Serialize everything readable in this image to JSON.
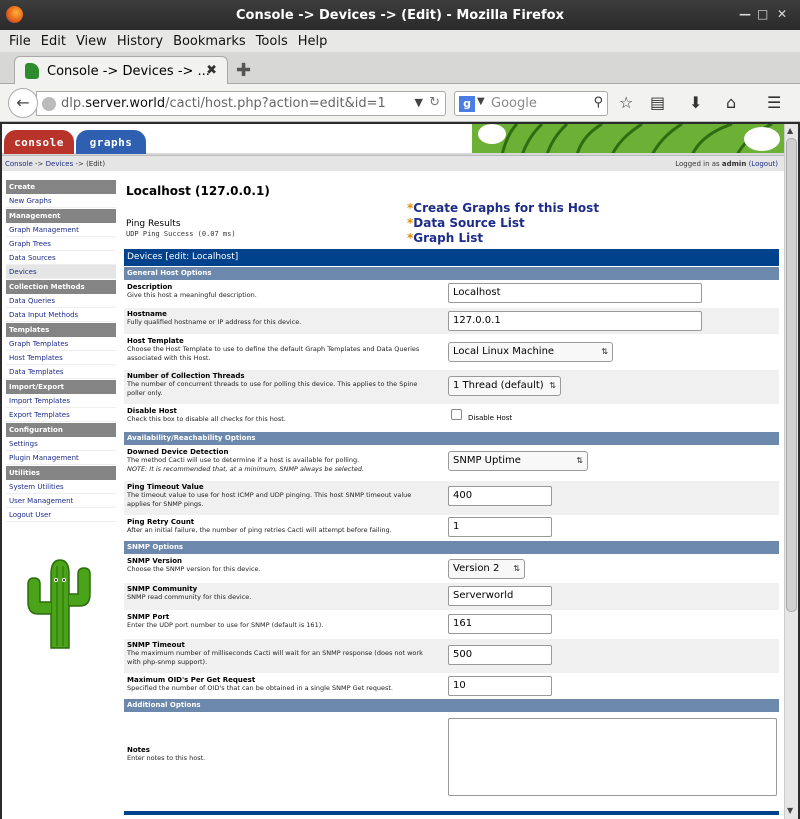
{
  "window": {
    "title": "Console -> Devices -> (Edit) - Mozilla Firefox"
  },
  "menu": [
    "File",
    "Edit",
    "View",
    "History",
    "Bookmarks",
    "Tools",
    "Help"
  ],
  "tab": {
    "label": "Console -> Devices -> ..."
  },
  "url": {
    "prefix": "dlp.",
    "domain": "server.world",
    "path": "/cacti/host.php?action=edit&id=1"
  },
  "search": {
    "placeholder": "Google"
  },
  "cacti": {
    "tabs": {
      "console": "console",
      "graphs": "graphs"
    },
    "breadcrumb": {
      "console": "Console",
      "sep1": " -> ",
      "devices": "Devices",
      "sep2": " -> ",
      "edit": "(Edit)"
    },
    "login": {
      "prefix": "Logged in as ",
      "user": "admin",
      "logout": "(Logout)"
    }
  },
  "sidebar": [
    {
      "type": "hd",
      "label": "Create"
    },
    {
      "type": "it",
      "label": "New Graphs"
    },
    {
      "type": "hd",
      "label": "Management"
    },
    {
      "type": "it",
      "label": "Graph Management"
    },
    {
      "type": "it",
      "label": "Graph Trees"
    },
    {
      "type": "it",
      "label": "Data Sources"
    },
    {
      "type": "it",
      "label": "Devices",
      "active": true
    },
    {
      "type": "hd",
      "label": "Collection Methods"
    },
    {
      "type": "it",
      "label": "Data Queries"
    },
    {
      "type": "it",
      "label": "Data Input Methods"
    },
    {
      "type": "hd",
      "label": "Templates"
    },
    {
      "type": "it",
      "label": "Graph Templates"
    },
    {
      "type": "it",
      "label": "Host Templates"
    },
    {
      "type": "it",
      "label": "Data Templates"
    },
    {
      "type": "hd",
      "label": "Import/Export"
    },
    {
      "type": "it",
      "label": "Import Templates"
    },
    {
      "type": "it",
      "label": "Export Templates"
    },
    {
      "type": "hd",
      "label": "Configuration"
    },
    {
      "type": "it",
      "label": "Settings"
    },
    {
      "type": "it",
      "label": "Plugin Management"
    },
    {
      "type": "hd",
      "label": "Utilities"
    },
    {
      "type": "it",
      "label": "System Utilities"
    },
    {
      "type": "it",
      "label": "User Management"
    },
    {
      "type": "it",
      "label": "Logout User"
    }
  ],
  "host": {
    "title": "Localhost (127.0.0.1)",
    "ping_label": "Ping Results",
    "ping_value": "UDP Ping Success (0.07 ms)",
    "links": [
      "Create Graphs for this Host",
      "Data Source List",
      "Graph List"
    ]
  },
  "devbar": {
    "title": "Devices",
    "sub": " [edit: Localhost]"
  },
  "sections": {
    "general": "General Host Options",
    "avail": "Availability/Reachability Options",
    "snmp": "SNMP Options",
    "additional": "Additional Options"
  },
  "fields": {
    "description": {
      "label": "Description",
      "desc": "Give this host a meaningful description.",
      "value": "Localhost"
    },
    "hostname": {
      "label": "Hostname",
      "desc": "Fully qualified hostname or IP address for this device.",
      "value": "127.0.0.1"
    },
    "host_template": {
      "label": "Host Template",
      "desc": "Choose the Host Template to use to define the default Graph Templates and Data Queries associated with this Host.",
      "value": "Local Linux Machine"
    },
    "threads": {
      "label": "Number of Collection Threads",
      "desc": "The number of concurrent threads to use for polling this device. This applies to the Spine poller only.",
      "value": "1 Thread (default)"
    },
    "disable": {
      "label": "Disable Host",
      "desc": "Check this box to disable all checks for this host.",
      "checkbox_label": "Disable Host"
    },
    "downed": {
      "label": "Downed Device Detection",
      "desc": "The method Cacti will use to determine if a host is available for polling.",
      "note": "NOTE: It is recommended that, at a minimum, SNMP always be selected.",
      "value": "SNMP Uptime"
    },
    "ping_timeout": {
      "label": "Ping Timeout Value",
      "desc": "The timeout value to use for host ICMP and UDP pinging. This host SNMP timeout value applies for SNMP pings.",
      "value": "400"
    },
    "ping_retry": {
      "label": "Ping Retry Count",
      "desc": "After an initial failure, the number of ping retries Cacti will attempt before failing.",
      "value": "1"
    },
    "snmp_version": {
      "label": "SNMP Version",
      "desc": "Choose the SNMP version for this device.",
      "value": "Version 2"
    },
    "snmp_community": {
      "label": "SNMP Community",
      "desc": "SNMP read community for this device.",
      "value": "Serverworld"
    },
    "snmp_port": {
      "label": "SNMP Port",
      "desc": "Enter the UDP port number to use for SNMP (default is 161).",
      "value": "161"
    },
    "snmp_timeout": {
      "label": "SNMP Timeout",
      "desc": "The maximum number of milliseconds Cacti will wait for an SNMP response (does not work with php-snmp support).",
      "value": "500"
    },
    "max_oids": {
      "label": "Maximum OID's Per Get Request",
      "desc": "Specified the number of OID's that can be obtained in a single SNMP Get request.",
      "value": "10"
    },
    "notes": {
      "label": "Notes",
      "desc": "Enter notes to this host.",
      "value": ""
    }
  }
}
